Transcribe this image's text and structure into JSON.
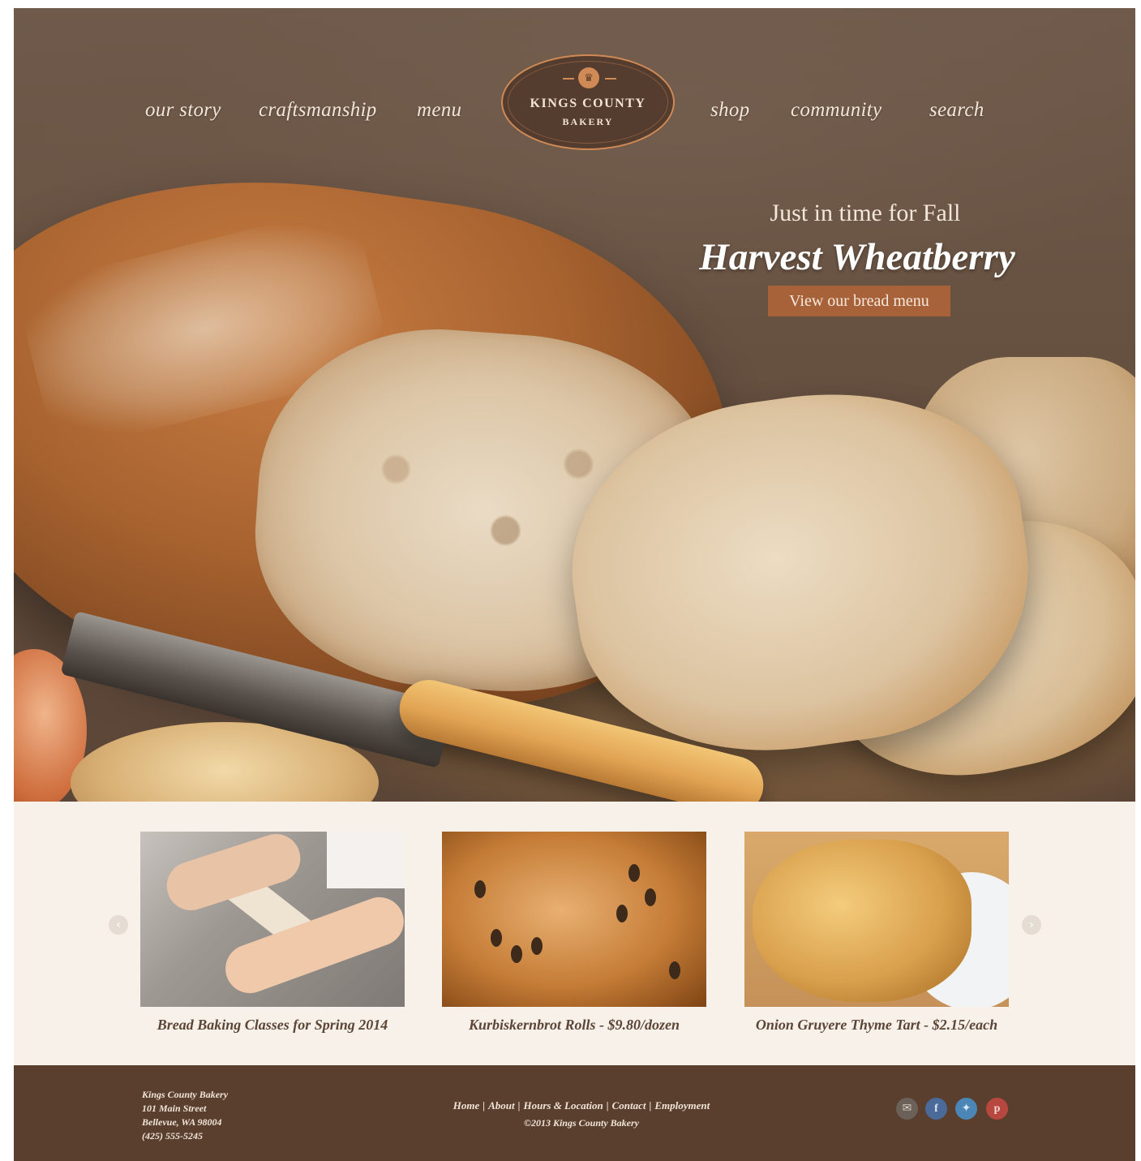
{
  "nav": {
    "left": [
      "our story",
      "craftsmanship",
      "menu"
    ],
    "right": [
      "shop",
      "community",
      "search"
    ]
  },
  "logo": {
    "name": "KINGS COUNTY",
    "sub": "BAKERY"
  },
  "promo": {
    "kicker": "Just in time for Fall",
    "title": "Harvest Wheatberry",
    "button": "View our bread menu"
  },
  "carousel": {
    "prev_icon": "chevron-left-icon",
    "next_icon": "chevron-right-icon",
    "cards": [
      {
        "caption": "Bread Baking Classes for Spring 2014"
      },
      {
        "caption": "Kurbiskernbrot Rolls - $9.80/dozen"
      },
      {
        "caption": "Onion Gruyere Thyme Tart - $2.15/each"
      }
    ]
  },
  "footer": {
    "address": [
      "Kings County Bakery",
      "101 Main Street",
      "Bellevue, WA 98004",
      "(425) 555-5245"
    ],
    "links": [
      "Home",
      "About",
      "Hours & Location",
      "Contact",
      "Employment"
    ],
    "copyright": "©2013 Kings County Bakery",
    "social": [
      {
        "icon": "mail-icon",
        "color": "#6b6159"
      },
      {
        "icon": "facebook-icon",
        "color": "#4a6a9a"
      },
      {
        "icon": "twitter-icon",
        "color": "#4c86b6"
      },
      {
        "icon": "pinterest-icon",
        "color": "#b8483f"
      }
    ]
  },
  "colors": {
    "accent": "#a8623a",
    "footer": "#5a3f2f",
    "cream": "#f8f1ea"
  }
}
